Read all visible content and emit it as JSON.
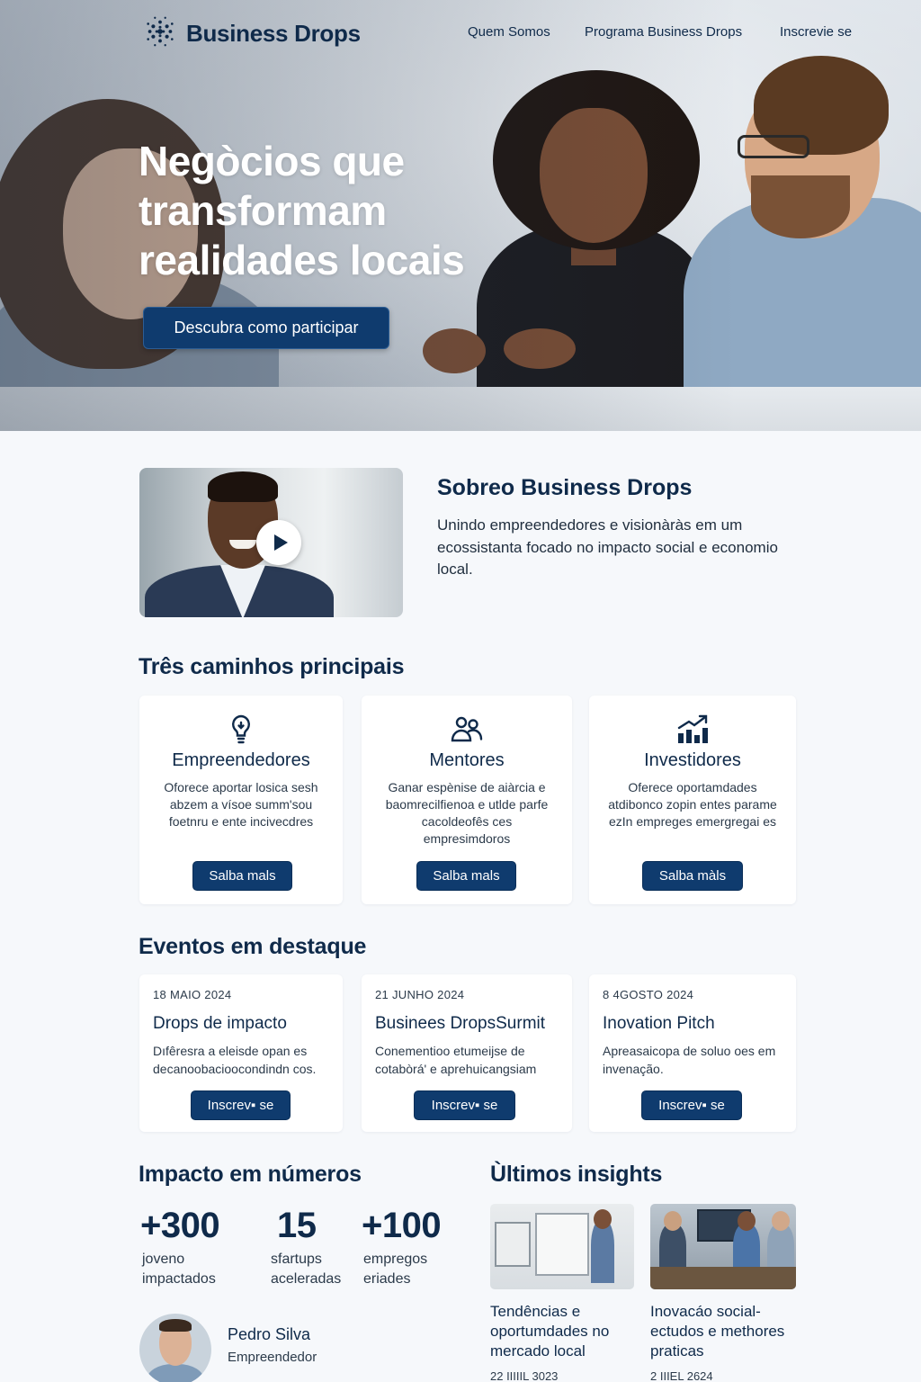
{
  "brand": {
    "name": "Business Drops"
  },
  "nav": {
    "items": [
      "Quem Somos",
      "Programa Business Drops",
      "Inscrevie se"
    ]
  },
  "hero": {
    "title": "Negòcios que transformam realidades locais",
    "cta": "Descubra como participar"
  },
  "about": {
    "title": "Sobreo Business Drops",
    "text": "Unindo empreendedores e visionàràs em um ecossistanta focado no impacto social e economio local."
  },
  "paths": {
    "title": "Três caminhos principais",
    "cards": [
      {
        "icon": "lightbulb-icon",
        "title": "Empreendedores",
        "desc": "Oforece aportar losica sesh abzem a vísoe summ'sou foetnru e ente incivecdres",
        "button": "Salba mals"
      },
      {
        "icon": "people-icon",
        "title": "Mentores",
        "desc": "Ganar espènise de aiàrcia e baomrecilfienoa e utlde parfe cacoldeofês ces empresimdoros",
        "button": "Salba mals"
      },
      {
        "icon": "growth-chart-icon",
        "title": "Investidores",
        "desc": "Oferece oportamdades atdibonco zopin entes parame ezIn empreges emergregai es",
        "button": "Salba màls"
      }
    ]
  },
  "events": {
    "title": "Eventos em destaque",
    "cards": [
      {
        "date": "18  MAIO 2024",
        "title": "Drops de impacto",
        "desc": "Dıfêresra a eleisde opan es decanoobacioocondindn cos.",
        "button": "Inscrev▪ se"
      },
      {
        "date": "21 JUNHO 2024",
        "title": "Businees DropsSurmit",
        "desc": "Conementioo etumeijse de cotabòrá'  e aprehuicangsiam",
        "button": "Inscrev▪ se"
      },
      {
        "date": "8 4GOSTO 2024",
        "title": "Inovation Pitch",
        "desc": "Apreasaicopa de soluo oes em invenação.",
        "button": "Inscrev▪ se"
      }
    ]
  },
  "impact": {
    "title": "Impacto em números",
    "stats": [
      {
        "value": "+300",
        "label": "joveno impactados"
      },
      {
        "value": "15",
        "label": "sfartups aceleradas"
      },
      {
        "value": "+100",
        "label": "empregos eriades"
      }
    ],
    "testimonial": {
      "name": "Pedro Silva",
      "role": "Empreendedor"
    }
  },
  "insights": {
    "title": "Ùltimos insights",
    "items": [
      {
        "title": "Tendências e oportumdades no mercado local",
        "date": "22 IIIIIL 3023"
      },
      {
        "title": "Inovacáo social- ectudos e methores praticas",
        "date": "2 IIIEL 2624"
      }
    ]
  },
  "colors": {
    "primary": "#0f3b6e",
    "text": "#0f2a4a",
    "background": "#f6f8fb"
  }
}
